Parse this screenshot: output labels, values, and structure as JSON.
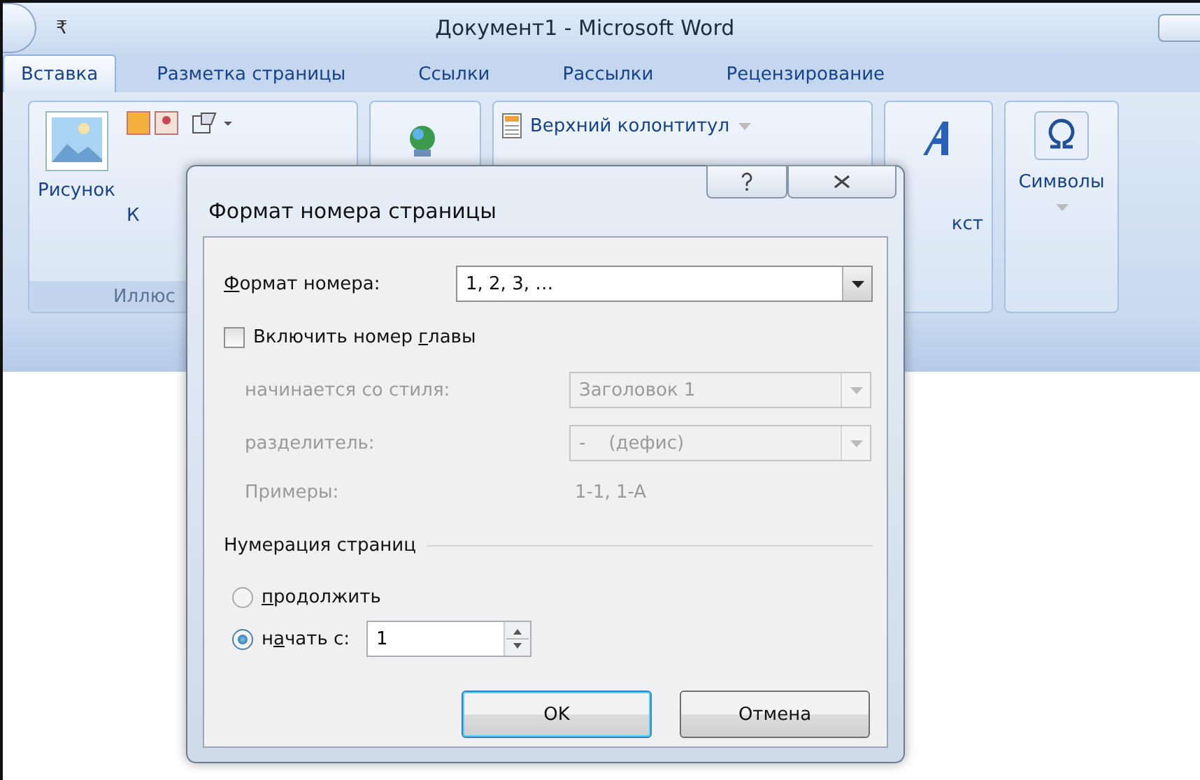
{
  "window": {
    "title": "Документ1 - Microsoft Word",
    "quick_access": "₹"
  },
  "tabs": [
    {
      "label": "Вставка",
      "selected": true
    },
    {
      "label": "Разметка страницы",
      "selected": false
    },
    {
      "label": "Ссылки",
      "selected": false
    },
    {
      "label": "Рассылки",
      "selected": false
    },
    {
      "label": "Рецензирование",
      "selected": false
    }
  ],
  "ribbon": {
    "picture_label": "Рисунок",
    "cut_label": "К",
    "group_label": "Иллюс",
    "header_label": "Верхний колонтитул",
    "text_label": "кст",
    "symbols_label": "Символы"
  },
  "dialog": {
    "title": "Формат номера страницы",
    "number_format": {
      "label": {
        "key": "Ф",
        "post": "ормат номера:"
      },
      "value": "1, 2, 3, …"
    },
    "include_chapter": {
      "label": {
        "pre": "Включить номер ",
        "key": "г",
        "post": "лавы"
      },
      "checked": false
    },
    "chapter_style": {
      "label": "начинается со стиля:",
      "value": "Заголовок 1",
      "disabled": true
    },
    "separator": {
      "label": "разделитель:",
      "value": "-    (дефис)",
      "disabled": true
    },
    "examples": {
      "label": "Примеры:",
      "value": "1-1, 1-A",
      "disabled": true
    },
    "numbering": {
      "heading": "Нумерация страниц",
      "options": [
        {
          "kind": "plain",
          "label": {
            "key": "п",
            "post": "родолжить"
          },
          "selected": false
        },
        {
          "kind": "spin",
          "label": {
            "pre": "н",
            "key": "а",
            "post": "чать с:"
          },
          "selected": true,
          "value": "1"
        }
      ]
    },
    "buttons": [
      {
        "label": "OK",
        "default": true
      },
      {
        "label": "Отмена",
        "default": false
      }
    ]
  }
}
